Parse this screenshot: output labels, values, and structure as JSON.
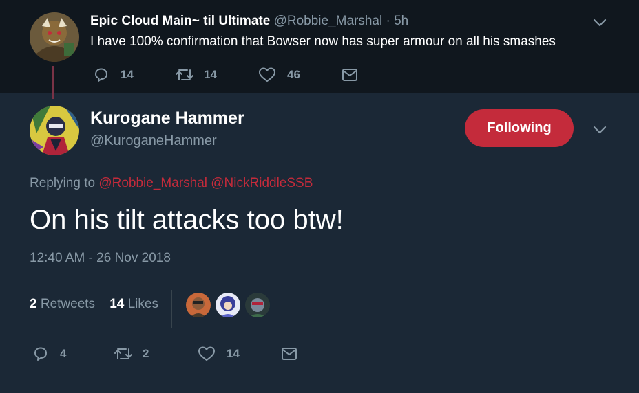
{
  "parent_tweet": {
    "display_name": "Epic Cloud Main~ til Ultimate",
    "handle": "@Robbie_Marshal",
    "time": "· 5h",
    "text": "I have 100% confirmation that Bowser now has super armour on all his smashes",
    "replies": "14",
    "retweets": "14",
    "likes": "46"
  },
  "main_tweet": {
    "display_name": "Kurogane Hammer",
    "handle": "@KuroganeHammer",
    "follow_label": "Following",
    "replying_prefix": "Replying to",
    "mention1": "@Robbie_Marshal",
    "mention2": "@NickRiddleSSB",
    "text": "On his tilt attacks too btw!",
    "timestamp": "12:40 AM - 26 Nov 2018",
    "retweet_count": "2",
    "retweet_label": "Retweets",
    "like_count": "14",
    "like_label": "Likes",
    "replies": "4",
    "retweets": "2",
    "likes": "14"
  },
  "colors": {
    "background": "#1b2836",
    "parent_background": "#10171e",
    "accent": "#c42b3b",
    "muted": "#8899a6",
    "divider": "#38444d"
  },
  "icons": [
    "reply-icon",
    "retweet-icon",
    "like-icon",
    "message-icon",
    "chevron-down-icon"
  ]
}
